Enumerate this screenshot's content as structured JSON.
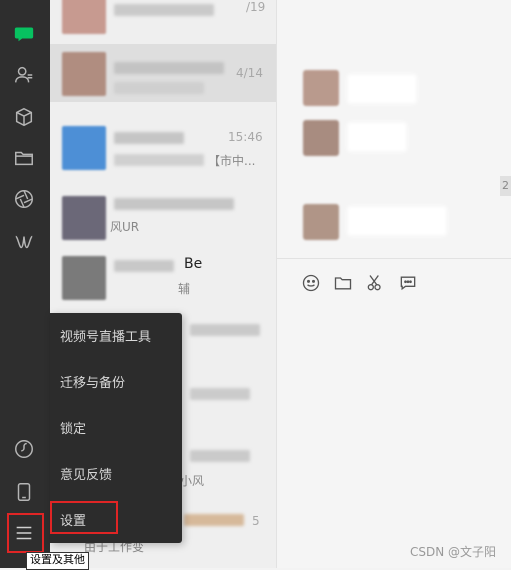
{
  "sidebar": {
    "icons": [
      "wechat-logo-icon",
      "contacts-icon",
      "favorites-cube-icon",
      "files-folder-icon",
      "moments-aperture-icon",
      "channels-icon",
      "mini-program-link-icon",
      "phone-icon",
      "menu-hamburger-icon"
    ]
  },
  "chat_list": {
    "rows": [
      {
        "time": "/19",
        "fragment": ""
      },
      {
        "time": "4/14",
        "fragment": ""
      },
      {
        "time": "15:46",
        "fragment": "【市中..."
      },
      {
        "time": "",
        "fragment": "风UR"
      },
      {
        "time": "",
        "fragment": "Be"
      },
      {
        "time": "",
        "fragment": "辅"
      },
      {
        "time": "",
        "fragment": "小风"
      },
      {
        "time": "5",
        "fragment": "由于工作变"
      }
    ]
  },
  "popup_menu": {
    "items": [
      "视频号直播工具",
      "迁移与备份",
      "锁定",
      "意见反馈",
      "设置"
    ]
  },
  "tooltip": {
    "text": "设置及其他"
  },
  "chat_area": {
    "toolbar": [
      "emoji-icon",
      "folder-icon",
      "scissors-icon",
      "chat-bubble-icon"
    ],
    "side_badge": "2"
  },
  "watermark": {
    "text": "CSDN @文子阳"
  },
  "colors": {
    "sidebar_bg": "#2e2e2e",
    "menu_bg": "#2c2c2c",
    "highlight": "#e02525",
    "wechat_green": "#07c160"
  }
}
